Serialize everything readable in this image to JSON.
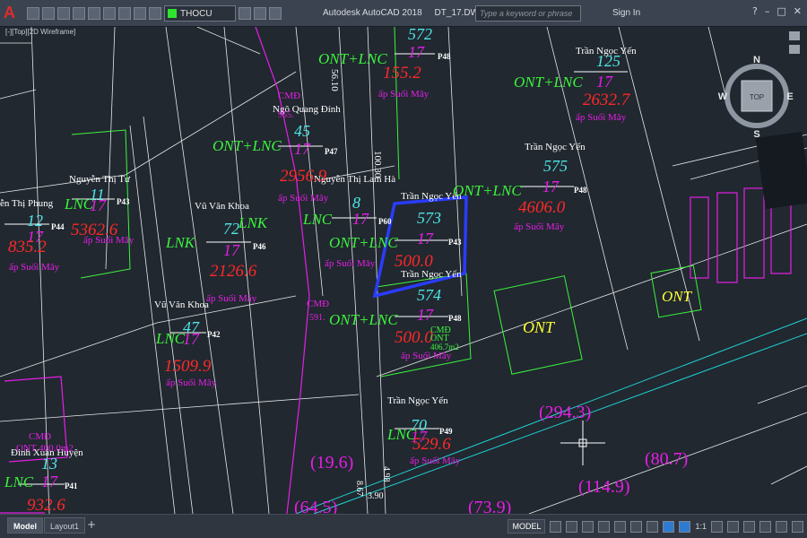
{
  "app": {
    "logo": "A",
    "title": "Autodesk AutoCAD 2018",
    "document": "DT_17.DWG",
    "search_placeholder": "Type a keyword or phrase",
    "signin": "Sign In",
    "layer": "THOCU",
    "viewport_label": "[-][Top][2D Wireframe]"
  },
  "viewcube": {
    "top": "TOP",
    "n": "N",
    "s": "S",
    "e": "E",
    "w": "W"
  },
  "tabs": [
    "Model",
    "Layout1"
  ],
  "status": {
    "model": "MODEL",
    "scale": "1:1"
  },
  "drawing": {
    "names": [
      {
        "id": "n1",
        "text": "Trần Ngọc Yến"
      },
      {
        "id": "n2",
        "text": "Ngô Quang Đính"
      },
      {
        "id": "n3",
        "text": "Trần Ngọc Yến"
      },
      {
        "id": "n4",
        "text": "Nguyễn Thị Tư"
      },
      {
        "id": "n5",
        "text": "Vũ Văn Khoa"
      },
      {
        "id": "n6",
        "text": "Nguyễn Thị Lam Hà"
      },
      {
        "id": "n7",
        "text": "Trần Ngọc Yến"
      },
      {
        "id": "n8",
        "text": "Trần Ngọc Yến"
      },
      {
        "id": "n9",
        "text": "ễn Thị Phung"
      },
      {
        "id": "n10",
        "text": "Vũ Văn Khoa"
      },
      {
        "id": "n11",
        "text": "Trần Ngọc Yến"
      },
      {
        "id": "n12",
        "text": "Đinh Xuân Huyện"
      }
    ],
    "types": [
      {
        "id": "t1",
        "text": "ONT+LNC"
      },
      {
        "id": "t2",
        "text": "ONT+LNC"
      },
      {
        "id": "t3",
        "text": "ONT+LNC"
      },
      {
        "id": "t4",
        "text": "LNC"
      },
      {
        "id": "t5",
        "text": "LNK"
      },
      {
        "id": "t6",
        "text": "LNK"
      },
      {
        "id": "t7",
        "text": "LNC"
      },
      {
        "id": "t8",
        "text": "ONT+LNC"
      },
      {
        "id": "t9",
        "text": "ONT+LNC"
      },
      {
        "id": "t10",
        "text": "ONT+LNC"
      },
      {
        "id": "t11",
        "text": "LNC"
      },
      {
        "id": "t12",
        "text": "LNC"
      },
      {
        "id": "t13",
        "text": "LNC"
      }
    ],
    "parcels": [
      {
        "id": "p572",
        "text": "572"
      },
      {
        "id": "p125",
        "text": "125"
      },
      {
        "id": "p45",
        "text": "45"
      },
      {
        "id": "p575",
        "text": "575"
      },
      {
        "id": "p11",
        "text": "11"
      },
      {
        "id": "p8",
        "text": "8"
      },
      {
        "id": "p573",
        "text": "573"
      },
      {
        "id": "p72",
        "text": "72"
      },
      {
        "id": "p12",
        "text": "12"
      },
      {
        "id": "p574",
        "text": "574"
      },
      {
        "id": "p47",
        "text": "47"
      },
      {
        "id": "p70",
        "text": "70"
      },
      {
        "id": "p13",
        "text": "13"
      }
    ],
    "sheets": [
      {
        "id": "s1",
        "text": "17"
      },
      {
        "id": "s2",
        "text": "17"
      },
      {
        "id": "s3",
        "text": "17"
      },
      {
        "id": "s4",
        "text": "17"
      },
      {
        "id": "s5",
        "text": "17"
      },
      {
        "id": "s6",
        "text": "17"
      },
      {
        "id": "s7",
        "text": "17"
      },
      {
        "id": "s8",
        "text": "17"
      },
      {
        "id": "s9",
        "text": "17"
      },
      {
        "id": "s10",
        "text": "17"
      },
      {
        "id": "s11",
        "text": "17"
      },
      {
        "id": "s12",
        "text": "17"
      },
      {
        "id": "s13",
        "text": "17"
      }
    ],
    "areas": [
      {
        "id": "a1",
        "text": "155.2"
      },
      {
        "id": "a2",
        "text": "2632.7"
      },
      {
        "id": "a3",
        "text": "2956.9"
      },
      {
        "id": "a4",
        "text": "4606.0"
      },
      {
        "id": "a5",
        "text": "5362.6"
      },
      {
        "id": "a6",
        "text": "500.0"
      },
      {
        "id": "a7",
        "text": "2126.6"
      },
      {
        "id": "a8",
        "text": "835.2"
      },
      {
        "id": "a9",
        "text": "500.0"
      },
      {
        "id": "a10",
        "text": "1509.9"
      },
      {
        "id": "a11",
        "text": "529.6"
      },
      {
        "id": "a12",
        "text": "932.6"
      }
    ],
    "p_codes": [
      {
        "id": "c1",
        "text": "P48"
      },
      {
        "id": "c2",
        "text": "P47"
      },
      {
        "id": "c3",
        "text": "P48"
      },
      {
        "id": "c4",
        "text": "P43"
      },
      {
        "id": "c5",
        "text": "P60"
      },
      {
        "id": "c6",
        "text": "P43"
      },
      {
        "id": "c7",
        "text": "P46"
      },
      {
        "id": "c8",
        "text": "P44"
      },
      {
        "id": "c9",
        "text": "P48"
      },
      {
        "id": "c10",
        "text": "P42"
      },
      {
        "id": "c11",
        "text": "P49"
      },
      {
        "id": "c12",
        "text": "P41"
      }
    ],
    "hamlets": [
      {
        "id": "h1",
        "text": "ấp Suối Mây"
      },
      {
        "id": "h2",
        "text": "ấp Suối Mây"
      },
      {
        "id": "h3",
        "text": "ấp Suối Mây"
      },
      {
        "id": "h4",
        "text": "ấp Suối Mây"
      },
      {
        "id": "h5",
        "text": "ấp Suối Mây"
      },
      {
        "id": "h6",
        "text": "ấp Suối Mây"
      },
      {
        "id": "h7",
        "text": "ấp Suối Mây"
      },
      {
        "id": "h8",
        "text": "ấp Suối Mây"
      },
      {
        "id": "h9",
        "text": "ấp Suối Mây"
      },
      {
        "id": "h10",
        "text": "ấp Suối Mây"
      },
      {
        "id": "h11",
        "text": "ấp Suối Mây"
      },
      {
        "id": "h12",
        "text": "ấp Suối Mây"
      }
    ],
    "cmd_labels": [
      {
        "id": "m1",
        "text": "CMĐ"
      },
      {
        "id": "m2",
        "text": "CMĐ"
      },
      {
        "id": "m3",
        "text": "CMĐ"
      },
      {
        "id": "m4",
        "text": "CMĐ"
      },
      {
        "id": "m5",
        "text": "ONT"
      },
      {
        "id": "m6",
        "text": "406.7m2"
      },
      {
        "id": "m7",
        "text": "ONT 400.0m2"
      },
      {
        "id": "m8",
        "text": "591."
      },
      {
        "id": "m9",
        "text": "955."
      }
    ],
    "ont_labels": [
      {
        "id": "o1",
        "text": "ONT"
      },
      {
        "id": "o2",
        "text": "ONT"
      }
    ],
    "road_labels": [
      {
        "id": "r1",
        "text": "(294.3)"
      },
      {
        "id": "r2",
        "text": "(19.6)"
      },
      {
        "id": "r3",
        "text": "(80.7)"
      },
      {
        "id": "r4",
        "text": "(114.9)"
      },
      {
        "id": "r5",
        "text": "(64.5)"
      },
      {
        "id": "r6",
        "text": "(73.9)"
      }
    ],
    "dims": [
      {
        "id": "d1",
        "text": "100.30"
      },
      {
        "id": "d2",
        "text": "56.10"
      },
      {
        "id": "d3",
        "text": "4.98"
      },
      {
        "id": "d4",
        "text": "3.90"
      },
      {
        "id": "d5",
        "text": "8.67"
      }
    ]
  },
  "colors": {
    "background": "#212830",
    "type_label": "#3cf53c",
    "parcel_number": "#4fe6e6",
    "sheet_number": "#e61ee6",
    "area": "#ff2828",
    "hamlet": "#e61ee6",
    "name": "#ffffff",
    "highlight": "#2a3cff",
    "ont_fill_label": "#ffff33",
    "road_label": "#e61ee6"
  }
}
